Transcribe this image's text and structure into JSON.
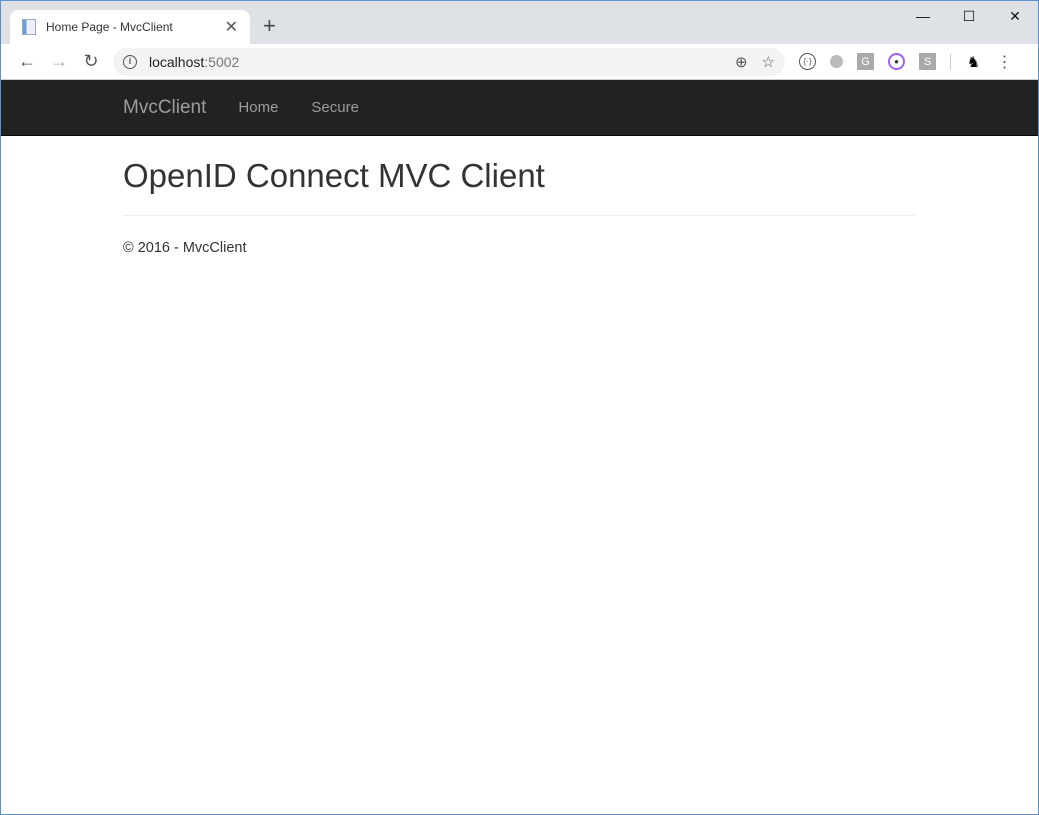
{
  "browser": {
    "tab_title": "Home Page - MvcClient",
    "url_host": "localhost",
    "url_port": ":5002",
    "icons": [
      "back-icon",
      "forward-icon",
      "reload-icon",
      "info-icon",
      "zoom-icon",
      "star-icon"
    ]
  },
  "navbar": {
    "brand": "MvcClient",
    "links": [
      {
        "label": "Home"
      },
      {
        "label": "Secure"
      }
    ]
  },
  "main": {
    "title": "OpenID Connect MVC Client"
  },
  "footer": {
    "text": "© 2016 - MvcClient"
  }
}
